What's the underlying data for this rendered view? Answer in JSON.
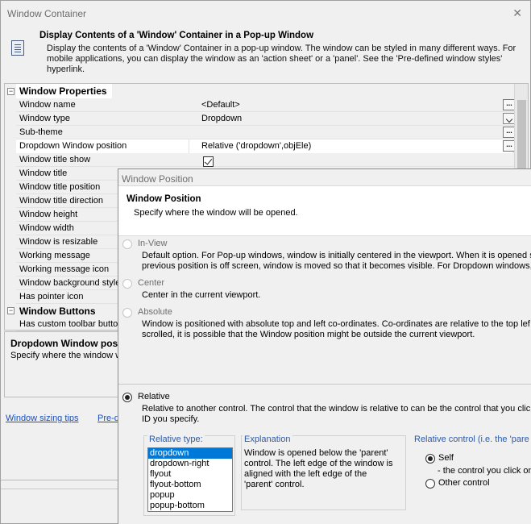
{
  "window": {
    "title": "Window Container"
  },
  "header": {
    "title": "Display Contents of a 'Window' Container in a Pop-up Window",
    "desc": "Display the contents of a 'Window' Container in a pop-up window. The window can be styled in many different ways. For mobile applications, you can display the window as an 'action sheet' or a 'panel'. See the 'Pre-defined window styles' hyperlink."
  },
  "grid": {
    "cat1": "Window Properties",
    "rows": [
      {
        "name": "Window name",
        "value": "<Default>"
      },
      {
        "name": "Window type",
        "value": "Dropdown"
      },
      {
        "name": "Sub-theme",
        "value": ""
      },
      {
        "name": "Dropdown Window position",
        "value": "Relative ('dropdown',objEle)"
      },
      {
        "name": "Window title show",
        "value": ""
      },
      {
        "name": "Window title",
        "value": ""
      },
      {
        "name": "Window title position",
        "value": ""
      },
      {
        "name": "Window title direction",
        "value": ""
      },
      {
        "name": "Window height",
        "value": ""
      },
      {
        "name": "Window width",
        "value": ""
      },
      {
        "name": "Window is resizable",
        "value": ""
      },
      {
        "name": "Working message",
        "value": ""
      },
      {
        "name": "Working message icon",
        "value": ""
      },
      {
        "name": "Window background style",
        "value": ""
      },
      {
        "name": "Has pointer icon",
        "value": ""
      }
    ],
    "cat2": "Window Buttons",
    "row_last": {
      "name": "Has custom toolbar button",
      "value": ""
    }
  },
  "description": {
    "title": "Dropdown Window positi",
    "text": "Specify where the window wi"
  },
  "links": {
    "sizing": "Window sizing tips",
    "predefined": "Pre-d"
  },
  "popup": {
    "title": "Window Position",
    "hdr_title": "Window Position",
    "hdr_desc": "Specify where the window will be opened.",
    "options": [
      {
        "label": "In-View",
        "line1": "Default option. For Pop-up windows, window is initially centered in the viewport. When it is opened s",
        "line2": "previous position is off screen, window is moved so that it becomes visible. For Dropdown windows, p"
      },
      {
        "label": "Center",
        "line1": "Center in the current viewport.",
        "line2": ""
      },
      {
        "label": "Absolute",
        "line1": "Window is positioned with absolute top and left co-ordinates. Co-ordinates are relative to the top lef",
        "line2": "scrolled, it is possible that the Window position might be outside the current viewport."
      },
      {
        "label": "Relative",
        "line1": "Relative to another control. The control that the window is relative to can be the control that you clic",
        "line2": "ID you specify."
      }
    ],
    "relative_type_label": "Relative type:",
    "relative_types": [
      "dropdown",
      "dropdown-right",
      "flyout",
      "flyout-bottom",
      "popup",
      "popup-bottom"
    ],
    "selected_type": "dropdown",
    "explanation_label": "Explanation",
    "explanation": "Window is opened below the 'parent' control. The left edge of the window is aligned with the left edge of the 'parent' control.",
    "relctrl_label": "Relative control (i.e. the 'pare",
    "self_label": "Self",
    "self_desc": "- the control you click on",
    "other_label": "Other control"
  }
}
